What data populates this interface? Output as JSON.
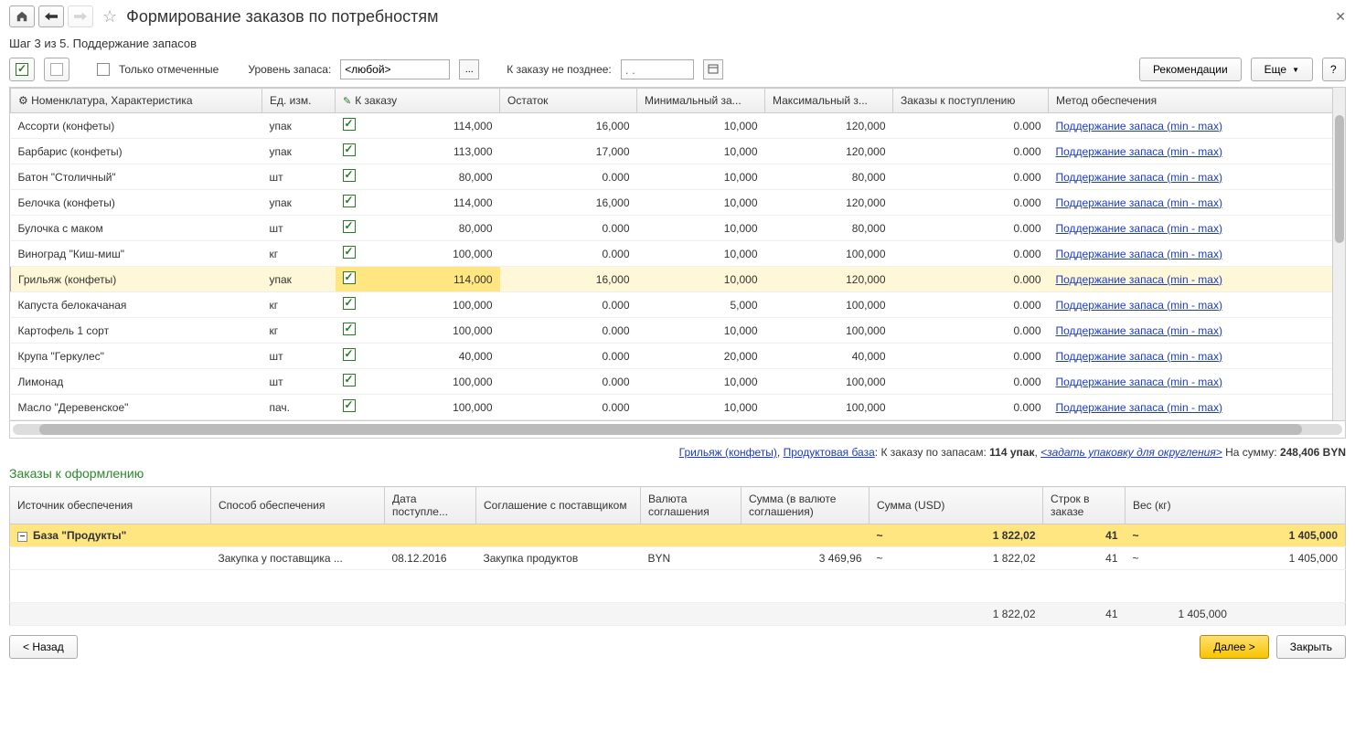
{
  "header": {
    "title": "Формирование заказов по потребностям",
    "step": "Шаг 3 из 5. Поддержание запасов"
  },
  "filter": {
    "only_checked": "Только отмеченные",
    "level_label": "Уровень запаса:",
    "level_value": "<любой>",
    "order_by_label": "К заказу не позднее:",
    "date_placeholder": ". .",
    "recommend": "Рекомендации",
    "more": "Еще",
    "help": "?"
  },
  "cols": {
    "nom": "Номенклатура, Характеристика",
    "unit": "Ед. изм.",
    "toorder": "К заказу",
    "rest": "Остаток",
    "min": "Минимальный за...",
    "max": "Максимальный з...",
    "incoming": "Заказы к поступлению",
    "method": "Метод обеспечения"
  },
  "method_link": "Поддержание запаса (min - max)",
  "rows": [
    {
      "n": "Ассорти (конфеты)",
      "u": "упак",
      "to": "114,000",
      "r": "16,000",
      "min": "10,000",
      "max": "120,000",
      "inc": "0.000"
    },
    {
      "n": "Барбарис (конфеты)",
      "u": "упак",
      "to": "113,000",
      "r": "17,000",
      "min": "10,000",
      "max": "120,000",
      "inc": "0.000"
    },
    {
      "n": "Батон \"Столичный\"",
      "u": "шт",
      "to": "80,000",
      "r": "0.000",
      "min": "10,000",
      "max": "80,000",
      "inc": "0.000"
    },
    {
      "n": "Белочка (конфеты)",
      "u": "упак",
      "to": "114,000",
      "r": "16,000",
      "min": "10,000",
      "max": "120,000",
      "inc": "0.000"
    },
    {
      "n": "Булочка с маком",
      "u": "шт",
      "to": "80,000",
      "r": "0.000",
      "min": "10,000",
      "max": "80,000",
      "inc": "0.000"
    },
    {
      "n": "Виноград \"Киш-миш\"",
      "u": "кг",
      "to": "100,000",
      "r": "0.000",
      "min": "10,000",
      "max": "100,000",
      "inc": "0.000"
    },
    {
      "n": "Грильяж (конфеты)",
      "u": "упак",
      "to": "114,000",
      "r": "16,000",
      "min": "10,000",
      "max": "120,000",
      "inc": "0.000",
      "sel": true
    },
    {
      "n": "Капуста белокачаная",
      "u": "кг",
      "to": "100,000",
      "r": "0.000",
      "min": "5,000",
      "max": "100,000",
      "inc": "0.000"
    },
    {
      "n": "Картофель 1 сорт",
      "u": "кг",
      "to": "100,000",
      "r": "0.000",
      "min": "10,000",
      "max": "100,000",
      "inc": "0.000"
    },
    {
      "n": "Крупа \"Геркулес\"",
      "u": "шт",
      "to": "40,000",
      "r": "0.000",
      "min": "20,000",
      "max": "40,000",
      "inc": "0.000"
    },
    {
      "n": "Лимонад",
      "u": "шт",
      "to": "100,000",
      "r": "0.000",
      "min": "10,000",
      "max": "100,000",
      "inc": "0.000"
    },
    {
      "n": "Масло \"Деревенское\"",
      "u": "пач.",
      "to": "100,000",
      "r": "0.000",
      "min": "10,000",
      "max": "100,000",
      "inc": "0.000"
    }
  ],
  "info": {
    "item_link": "Грильяж (конфеты)",
    "base_link": "Продуктовая база",
    "pre": ": К заказу по запасам: ",
    "qty": "114 упак",
    "comma": ", ",
    "pack_link": "<задать упаковку для округления>",
    "sum_pre": " На сумму: ",
    "sum": "248,406 BYN"
  },
  "orders": {
    "title": "Заказы к оформлению",
    "cols": {
      "src": "Источник обеспечения",
      "method": "Способ обеспечения",
      "date": "Дата поступле...",
      "agree": "Соглашение с поставщиком",
      "curr": "Валюта соглашения",
      "sum_curr": "Сумма (в валюте соглашения)",
      "sum_usd": "Сумма (USD)",
      "lines": "Строк в заказе",
      "weight": "Вес (кг)"
    },
    "group": {
      "src": "База \"Продукты\"",
      "usd_t": "~",
      "usd": "1 822,02",
      "lines": "41",
      "w_t": "~",
      "w": "1 405,000"
    },
    "row": {
      "method": "Закупка у поставщика ...",
      "date": "08.12.2016",
      "agree": "Закупка продуктов",
      "curr": "BYN",
      "sum": "3 469,96",
      "usd_t": "~",
      "usd": "1 822,02",
      "lines": "41",
      "w_t": "~",
      "w": "1 405,000"
    },
    "foot": {
      "usd": "1 822,02",
      "lines": "41",
      "w": "1 405,000"
    }
  },
  "footer": {
    "back": "< Назад",
    "next": "Далее >",
    "close": "Закрыть"
  }
}
